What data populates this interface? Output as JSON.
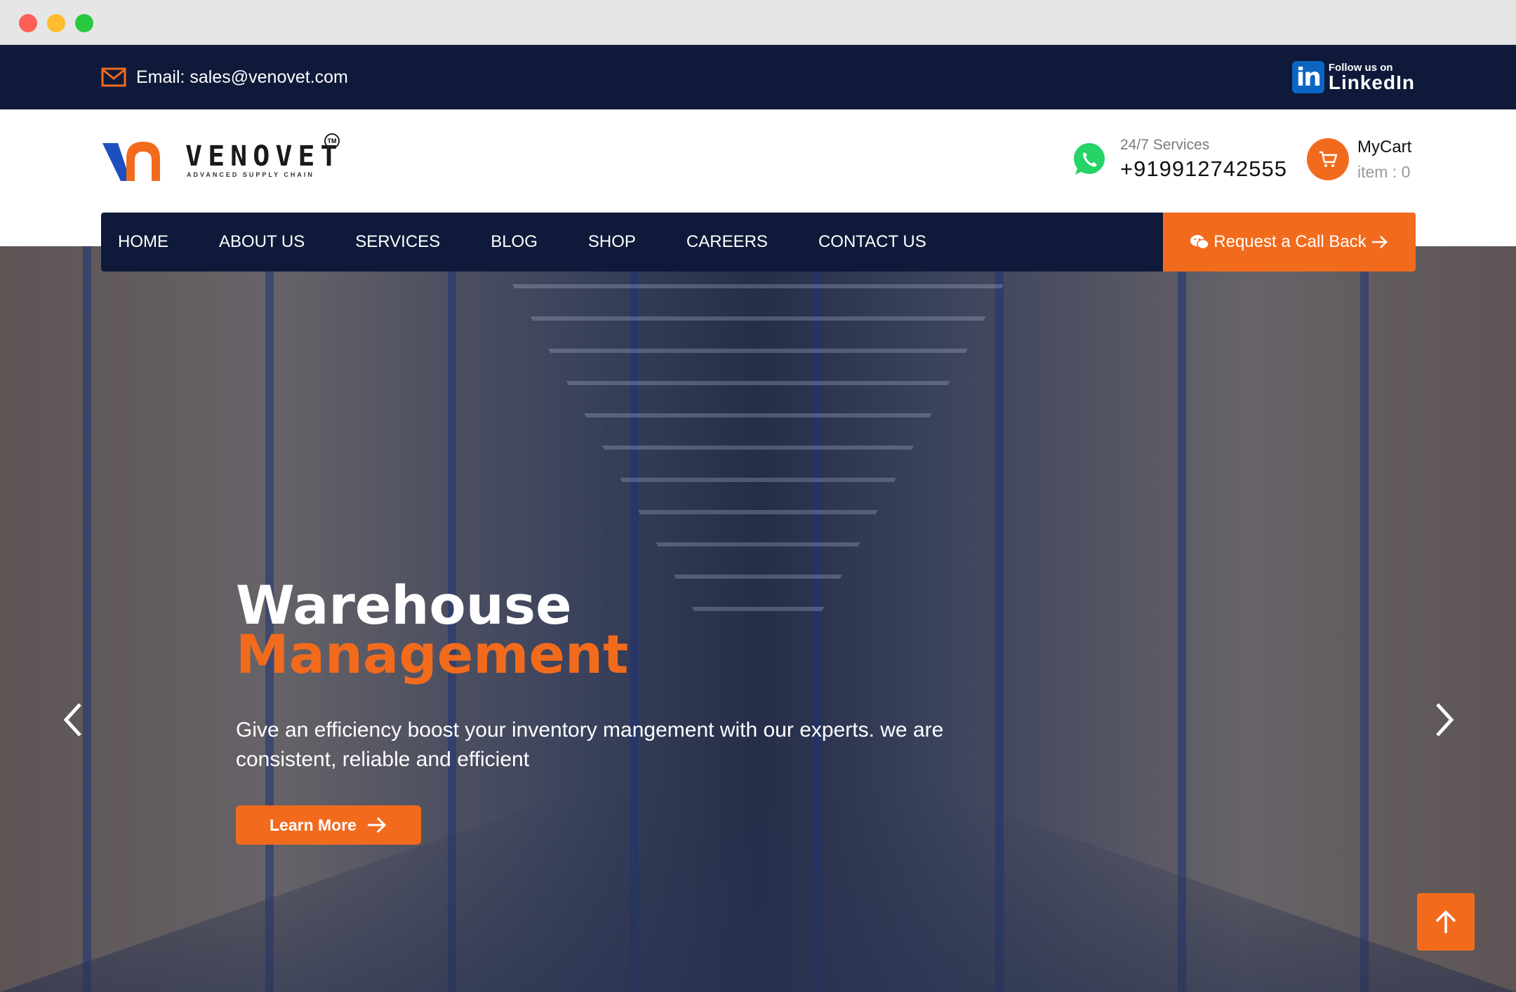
{
  "topbar": {
    "email_label": "Email: sales@venovet.com",
    "linkedin_small": "Follow us on",
    "linkedin_big": "LinkedIn",
    "linkedin_mark": "in"
  },
  "header": {
    "logo_word": "VENOVET",
    "logo_tagline": "ADVANCED SUPPLY CHAIN",
    "logo_tm": "TM",
    "services_label": "24/7 Services",
    "phone": "+919912742555",
    "cart_title": "MyCart",
    "cart_count": "item : 0"
  },
  "nav": {
    "items": [
      "HOME",
      "ABOUT US",
      "SERVICES",
      "BLOG",
      "SHOP",
      "CAREERS",
      "CONTACT US"
    ],
    "cta_label": "Request a Call Back"
  },
  "hero": {
    "title_line1": "Warehouse",
    "title_line2": "Management",
    "description": "Give an efficiency boost your inventory mangement with our experts. we are consistent, reliable and efficient",
    "button_label": "Learn More"
  },
  "colors": {
    "navy": "#0f1a3a",
    "accent": "#f26b1d",
    "linkedin": "#0a66c2",
    "whatsapp": "#25d366"
  },
  "icons": [
    "email-icon",
    "linkedin-icon",
    "whatsapp-icon",
    "cart-icon",
    "wechat-icon",
    "arrow-right-icon",
    "chevron-left-icon",
    "chevron-right-icon",
    "arrow-up-icon"
  ]
}
